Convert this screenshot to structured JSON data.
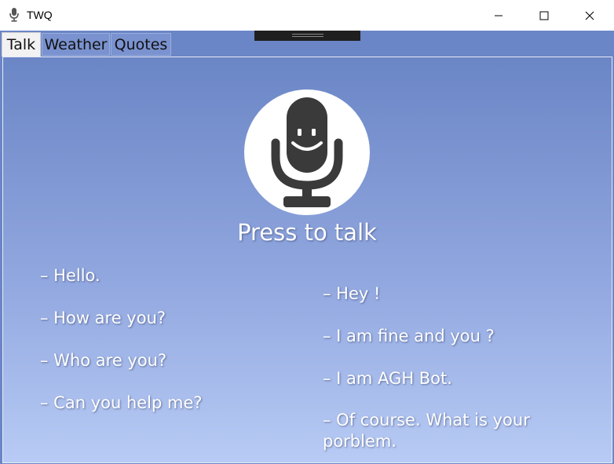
{
  "window": {
    "title": "TWQ",
    "app_icon": "microphone-icon",
    "controls": [
      "minimize-icon",
      "maximize-icon",
      "close-icon"
    ]
  },
  "tabs": [
    {
      "label": "Talk",
      "selected": true
    },
    {
      "label": "Weather",
      "selected": false
    },
    {
      "label": "Quotes",
      "selected": false
    }
  ],
  "talk": {
    "mic_icon": "smiling-microphone-icon",
    "press_label": "Press to talk",
    "user_lines": [
      "– Hello.",
      "– How are you?",
      "– Who are you?",
      "– Can you help me?"
    ],
    "bot_lines": [
      "– Hey !",
      "– I am fine and you ?",
      "– I am AGH Bot.",
      "– Of course. What is your porblem."
    ]
  },
  "colors": {
    "panel_top": "#6b86c6",
    "panel_bottom": "#b8cbf5",
    "mic_body": "#3a3a3a"
  }
}
